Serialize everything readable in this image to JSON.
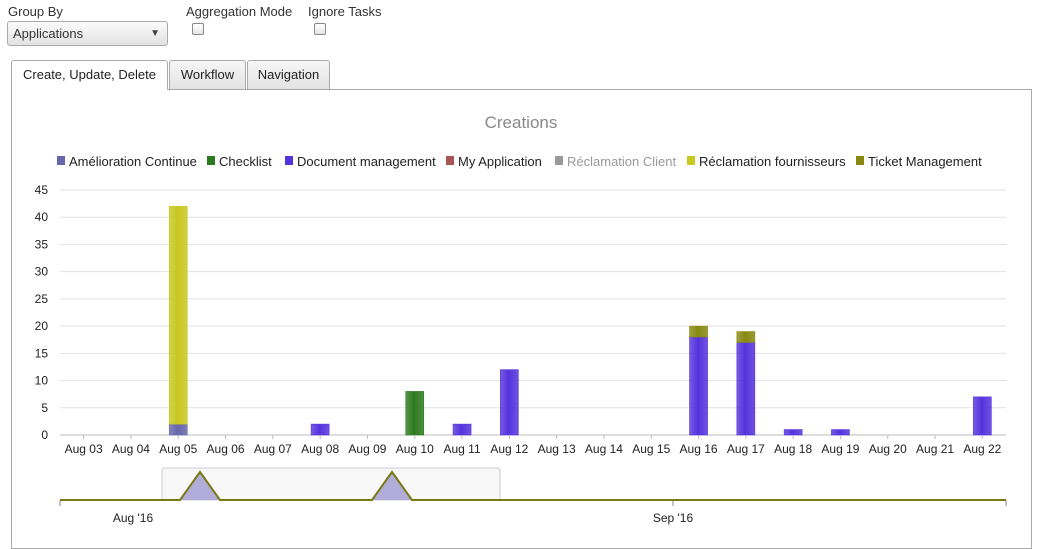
{
  "controls": {
    "group_by_label": "Group By",
    "group_by_value": "Applications",
    "aggregation_label": "Aggregation Mode",
    "ignore_tasks_label": "Ignore Tasks"
  },
  "tabs": [
    {
      "label": "Create, Update, Delete",
      "active": true
    },
    {
      "label": "Workflow",
      "active": false
    },
    {
      "label": "Navigation",
      "active": false
    }
  ],
  "chart_data": {
    "type": "bar",
    "stacked": true,
    "title": "Creations",
    "xlabel": "",
    "ylabel": "",
    "ylim": [
      0,
      45
    ],
    "yticks": [
      0,
      5,
      10,
      15,
      20,
      25,
      30,
      35,
      40,
      45
    ],
    "grid": true,
    "legend_position": "top",
    "categories": [
      "Aug 03",
      "Aug 04",
      "Aug 05",
      "Aug 06",
      "Aug 07",
      "Aug 08",
      "Aug 09",
      "Aug 10",
      "Aug 11",
      "Aug 12",
      "Aug 13",
      "Aug 14",
      "Aug 15",
      "Aug 16",
      "Aug 17",
      "Aug 18",
      "Aug 19",
      "Aug 20",
      "Aug 21",
      "Aug 22"
    ],
    "series": [
      {
        "name": "Amélioration Continue",
        "color": "#6666aa",
        "values": [
          0,
          0,
          2,
          0,
          0,
          0,
          0,
          0,
          0,
          0,
          0,
          0,
          0,
          0,
          0,
          0,
          0,
          0,
          0,
          0
        ]
      },
      {
        "name": "Checklist",
        "color": "#2b7a1e",
        "values": [
          0,
          0,
          0,
          0,
          0,
          0,
          0,
          8,
          0,
          0,
          0,
          0,
          0,
          0,
          0,
          0,
          0,
          0,
          0,
          0
        ]
      },
      {
        "name": "Document management",
        "color": "#5533dd",
        "values": [
          0,
          0,
          0,
          0,
          0,
          2,
          0,
          0,
          2,
          12,
          0,
          0,
          0,
          18,
          17,
          1,
          1,
          0,
          0,
          7
        ]
      },
      {
        "name": "My Application",
        "color": "#aa5555",
        "values": [
          0,
          0,
          0,
          0,
          0,
          0,
          0,
          0,
          0,
          0,
          0,
          0,
          0,
          0,
          0,
          0,
          0,
          0,
          0,
          0
        ]
      },
      {
        "name": "Réclamation Client",
        "color": "#999999",
        "hidden": true,
        "values": [
          0,
          0,
          0,
          0,
          0,
          0,
          0,
          0,
          0,
          0,
          0,
          0,
          0,
          0,
          0,
          0,
          0,
          0,
          0,
          0
        ]
      },
      {
        "name": "Réclamation fournisseurs",
        "color": "#c8c820",
        "values": [
          0,
          0,
          40,
          0,
          0,
          0,
          0,
          0,
          0,
          0,
          0,
          0,
          0,
          0,
          0,
          0,
          0,
          0,
          0,
          0
        ]
      },
      {
        "name": "Ticket Management",
        "color": "#888811",
        "values": [
          0,
          0,
          0,
          0,
          0,
          0,
          0,
          0,
          0,
          0,
          0,
          0,
          0,
          2,
          2,
          0,
          0,
          0,
          0,
          0
        ]
      }
    ],
    "navigator": {
      "labels": [
        "Aug '16",
        "Sep '16"
      ]
    }
  }
}
